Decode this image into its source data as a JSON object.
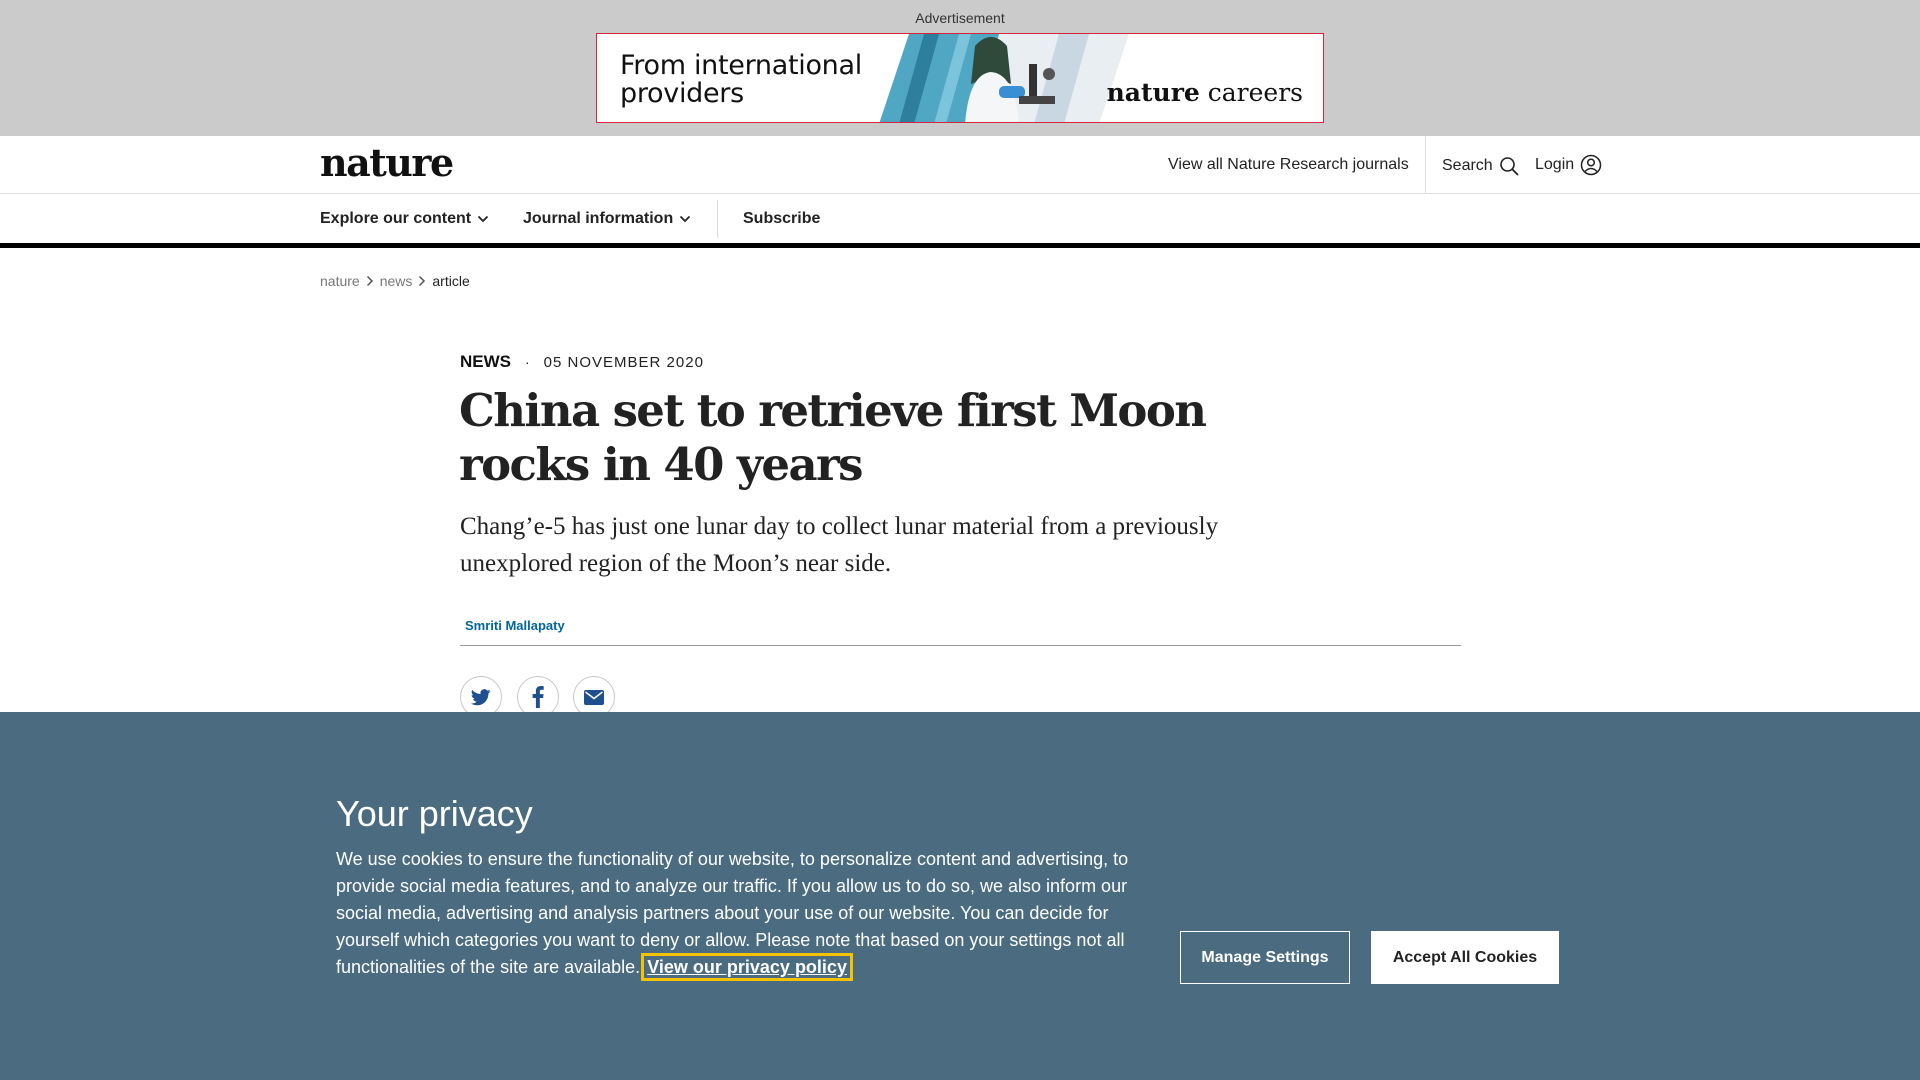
{
  "ad": {
    "label": "Advertisement",
    "line1": "From international",
    "line2": "providers",
    "brand_bold": "nature",
    "brand_light": " careers"
  },
  "header": {
    "logo": "nature",
    "journals_link": "View all Nature Research journals",
    "search_label": "Search",
    "login_label": "Login"
  },
  "nav": {
    "explore": "Explore our content",
    "journal_info": "Journal information",
    "subscribe": "Subscribe"
  },
  "breadcrumb": {
    "items": [
      "nature",
      "news",
      "article"
    ]
  },
  "article": {
    "type": "NEWS",
    "date": "05 NOVEMBER 2020",
    "title": "China set to retrieve first Moon rocks in 40 years",
    "standfirst": "Chang’e-5 has just one lunar day to collect lunar material from a previously unexplored region of the Moon’s near side.",
    "author": "Smriti Mallapaty"
  },
  "share": {
    "icons": [
      "twitter-icon",
      "facebook-icon",
      "email-icon"
    ]
  },
  "cookie": {
    "title": "Your privacy",
    "text": "We use cookies to ensure the functionality of our website, to personalize content and advertising, to provide social media features, and to analyze our traffic. If you allow us to do so, we also inform our social media, advertising and analysis partners about your use of our website. You can decide for yourself which categories you want to deny or allow. Please note that based on your settings not all functionalities of the site are available.",
    "link": "View our privacy policy",
    "manage": "Manage Settings",
    "accept": "Accept All Cookies"
  },
  "colors": {
    "cookie_bg": "#4a6b80",
    "link_blue": "#00669b",
    "focus_outline": "#f5c200",
    "ad_band": "#cbcbcb"
  }
}
